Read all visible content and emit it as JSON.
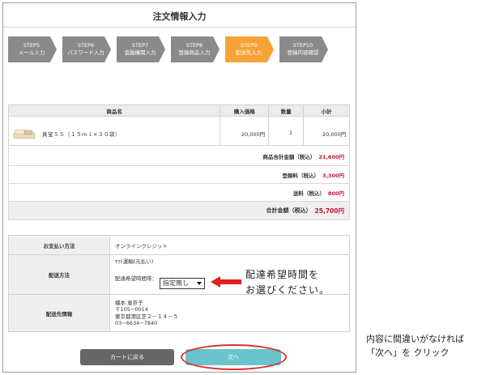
{
  "page": {
    "title": "注文情報入力"
  },
  "steps": [
    {
      "num": "STEP5",
      "label": "メール入力",
      "active": false
    },
    {
      "num": "STEP6",
      "label": "パスワード入力",
      "active": false
    },
    {
      "num": "STEP7",
      "label": "金融機関入力",
      "active": false
    },
    {
      "num": "STEP8",
      "label": "登録商品入力",
      "active": false
    },
    {
      "num": "STEP9",
      "label": "配送先入力",
      "active": true
    },
    {
      "num": "STEP10",
      "label": "登録内容確認",
      "active": false
    }
  ],
  "colors": {
    "step_inactive": "#8a8a8a",
    "step_active": "#f7a237",
    "price_red": "#c8102e",
    "back_button": "#666666",
    "next_button": "#69c4cc",
    "highlight": "#e03030"
  },
  "product_table": {
    "headers": [
      "商品名",
      "購入価格",
      "数量",
      "小計"
    ],
    "rows": [
      {
        "name": "真宝ＳＳ（１５ｍｌ×３０袋）",
        "price": "20,000円",
        "qty": "1",
        "subtotal": "20,000円"
      }
    ]
  },
  "summary": {
    "goods_total_label": "商品合計金額（税込）",
    "goods_total_value": "21,600",
    "goods_total_unit": "円",
    "reg_fee_label": "登録料（税込）",
    "reg_fee_value": "3,300",
    "reg_fee_unit": "円",
    "shipping_label": "送料（税込）",
    "shipping_value": "800",
    "shipping_unit": "円",
    "grand_total_label": "合計金額（税込）",
    "grand_total_value": "25,700",
    "grand_total_unit": "円"
  },
  "info": {
    "payment_label": "お支払い方法",
    "payment_value": "オンラインクレジット",
    "delivery_label": "配送方法",
    "delivery_value": "ﾔﾏﾄ運輸(元払い)",
    "time_label": "配達希望時間帯：",
    "time_select": "指定無し",
    "address_label": "配送先情報",
    "address_lines": [
      "榎本 恵奈子",
      "〒105−0014",
      "東京都港区芝２－１４－５",
      "03−6634−7840"
    ]
  },
  "buttons": {
    "back": "カートに戻る",
    "next": "次へ"
  },
  "annotations": {
    "callout_line1": "配達希望時間を",
    "callout_line2": "お選びください。",
    "note_line1": "内容に間違いがなければ",
    "note_line2": "「次へ」を クリック"
  }
}
